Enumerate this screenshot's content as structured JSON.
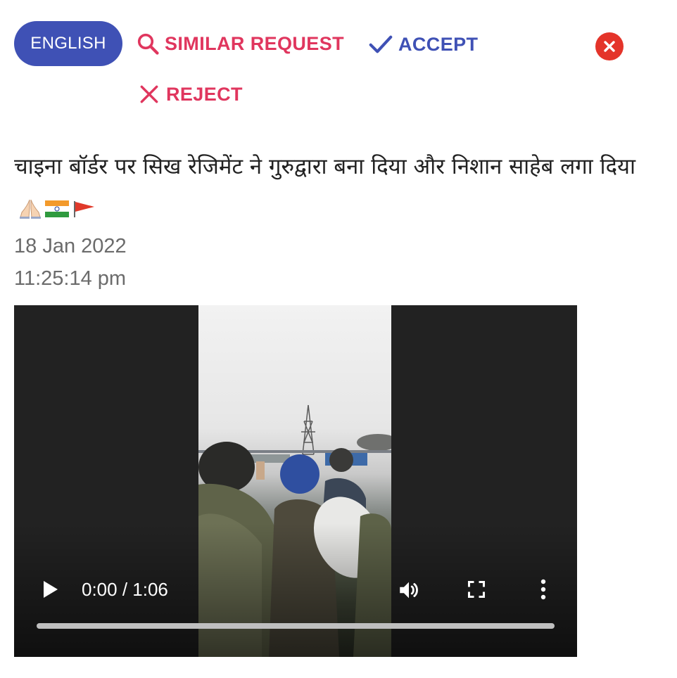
{
  "toolbar": {
    "language_label": "ENGLISH",
    "similar_request_label": "SIMILAR REQUEST",
    "accept_label": "ACCEPT",
    "reject_label": "REJECT",
    "close_icon": "close-circle-icon"
  },
  "colors": {
    "primary": "#3f51b5",
    "danger": "#e0365e",
    "close_red": "#e4342a"
  },
  "post": {
    "text": "चाइना बॉर्डर पर सिख रेजिमेंट ने गुरुद्वारा बना दिया और निशान साहेब लगा दिया",
    "emojis": [
      "folded-hands-icon",
      "india-flag-icon",
      "triangular-flag-icon"
    ],
    "date": "18 Jan 2022",
    "time": "11:25:14 pm"
  },
  "video": {
    "time_display": "0:00 / 1:06",
    "progress": 0,
    "controls": [
      "play-icon",
      "volume-icon",
      "fullscreen-icon",
      "more-vert-icon"
    ]
  }
}
